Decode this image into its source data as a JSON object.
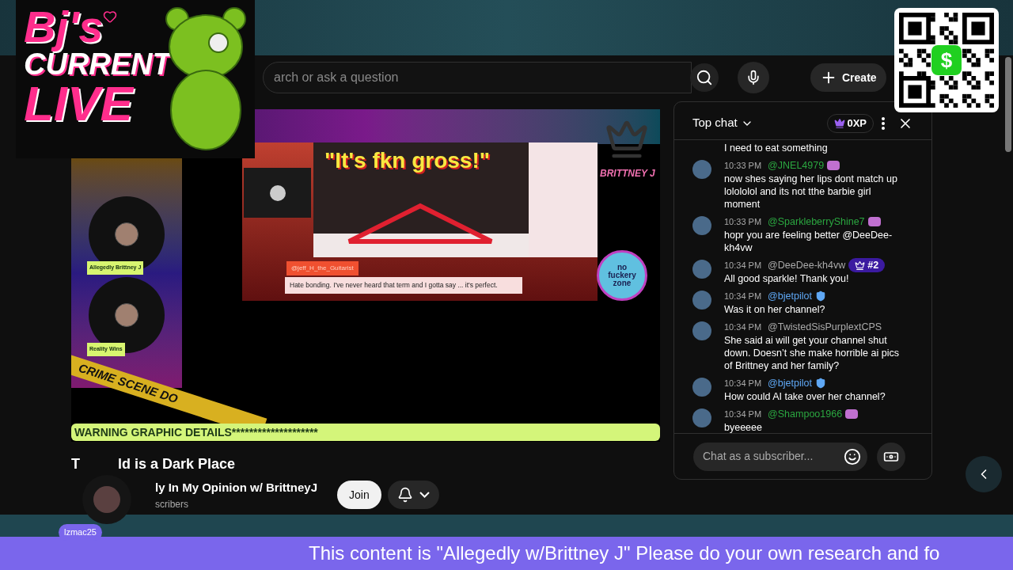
{
  "logo": {
    "lines": [
      "Bj's",
      "CURRENT",
      "LIVE"
    ]
  },
  "qr": {
    "center_glyph": "$"
  },
  "top_bar": {
    "search": {
      "placeholder": "arch or ask a question"
    },
    "create_button": "Create"
  },
  "video": {
    "caption": "\"It's fkn gross!\"",
    "brand": "BRITTNEY J",
    "commenter": "@jeff_H_the_Guitarist",
    "comment": "Hate bonding. I've never heard that term and I gotta say ... it's perfect.",
    "badge": "no fuckery zone",
    "guests": [
      {
        "name": "Allegedly Brittney J"
      },
      {
        "name": "Reality Wins"
      }
    ],
    "tape": "CRIME SCENE DO",
    "warning": "WARNING GRAPHIC DETAILS********************"
  },
  "title_parts": [
    "T",
    "ld is a Dark Place"
  ],
  "channel": {
    "name": "ly In My Opinion w/ BrittneyJ",
    "subscribers": "scribers",
    "join_button": "Join"
  },
  "viewer_overlay": {
    "name": "lzmac25"
  },
  "chat": {
    "mode": "Top chat",
    "xp": "0XP",
    "placeholder": "Chat as a subscriber...",
    "messages": [
      {
        "text": "I need to eat something"
      },
      {
        "time": "10:33 PM",
        "author": "@JNEL4979",
        "kind": "member",
        "text": "now shes saying her lips dont match up lolololol and its not tthe barbie girl moment"
      },
      {
        "time": "10:33 PM",
        "author": "@SparkleberryShine7",
        "kind": "member",
        "text": "hopr you are feeling better @DeeDee-kh4vw"
      },
      {
        "time": "10:34 PM",
        "author": "@DeeDee-kh4vw",
        "kind": "plain",
        "rank": "#2",
        "text": "All good sparkle! Thank you!"
      },
      {
        "time": "10:34 PM",
        "author": "@bjetpilot",
        "kind": "verified",
        "text": "Was it on her channel?"
      },
      {
        "time": "10:34 PM",
        "author": "@TwistedSisPurplextCPS",
        "kind": "plain",
        "text": "She said ai will get your channel shut down. Doesn’t she make horrible ai pics of Brittney and her family?"
      },
      {
        "time": "10:34 PM",
        "author": "@bjetpilot",
        "kind": "verified",
        "text": "How could AI take over her channel?"
      },
      {
        "time": "10:34 PM",
        "author": "@Shampoo1966",
        "kind": "member",
        "text": "byeeeee"
      }
    ]
  },
  "ticker": "This content is \"Allegedly w/Brittney J\" Please do your own research and fo"
}
